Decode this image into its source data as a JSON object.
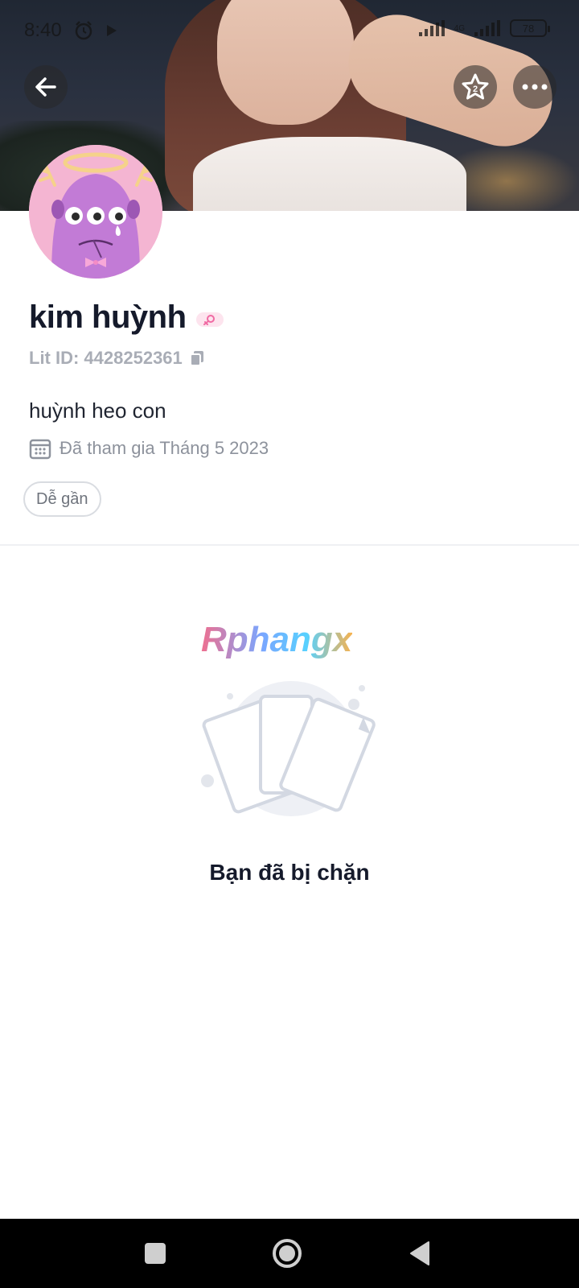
{
  "status_bar": {
    "time": "8:40",
    "network_label": "4G",
    "battery": "78"
  },
  "profile": {
    "name": "kim huỳnh",
    "lit_id": "Lit ID: 4428252361",
    "bio": "huỳnh heo con",
    "joined": "Đã tham gia Tháng 5 2023",
    "tags": [
      "Dễ gần"
    ]
  },
  "blocked": {
    "watermark": "Rphangx",
    "message": "Bạn đã bị chặn"
  },
  "colors": {
    "avatar_bg": "#f4b5d2",
    "avatar_monster": "#c27bd6",
    "gender_badge": "#f06aa3",
    "navbar_bg": "#000000"
  },
  "icons": {
    "back": "arrow-left-icon",
    "star": "star-icon",
    "more": "more-horizontal-icon",
    "copy": "copy-icon",
    "calendar": "calendar-icon",
    "gender": "female-icon",
    "nav_recents": "square-icon",
    "nav_home": "circle-icon",
    "nav_back": "triangle-back-icon"
  }
}
